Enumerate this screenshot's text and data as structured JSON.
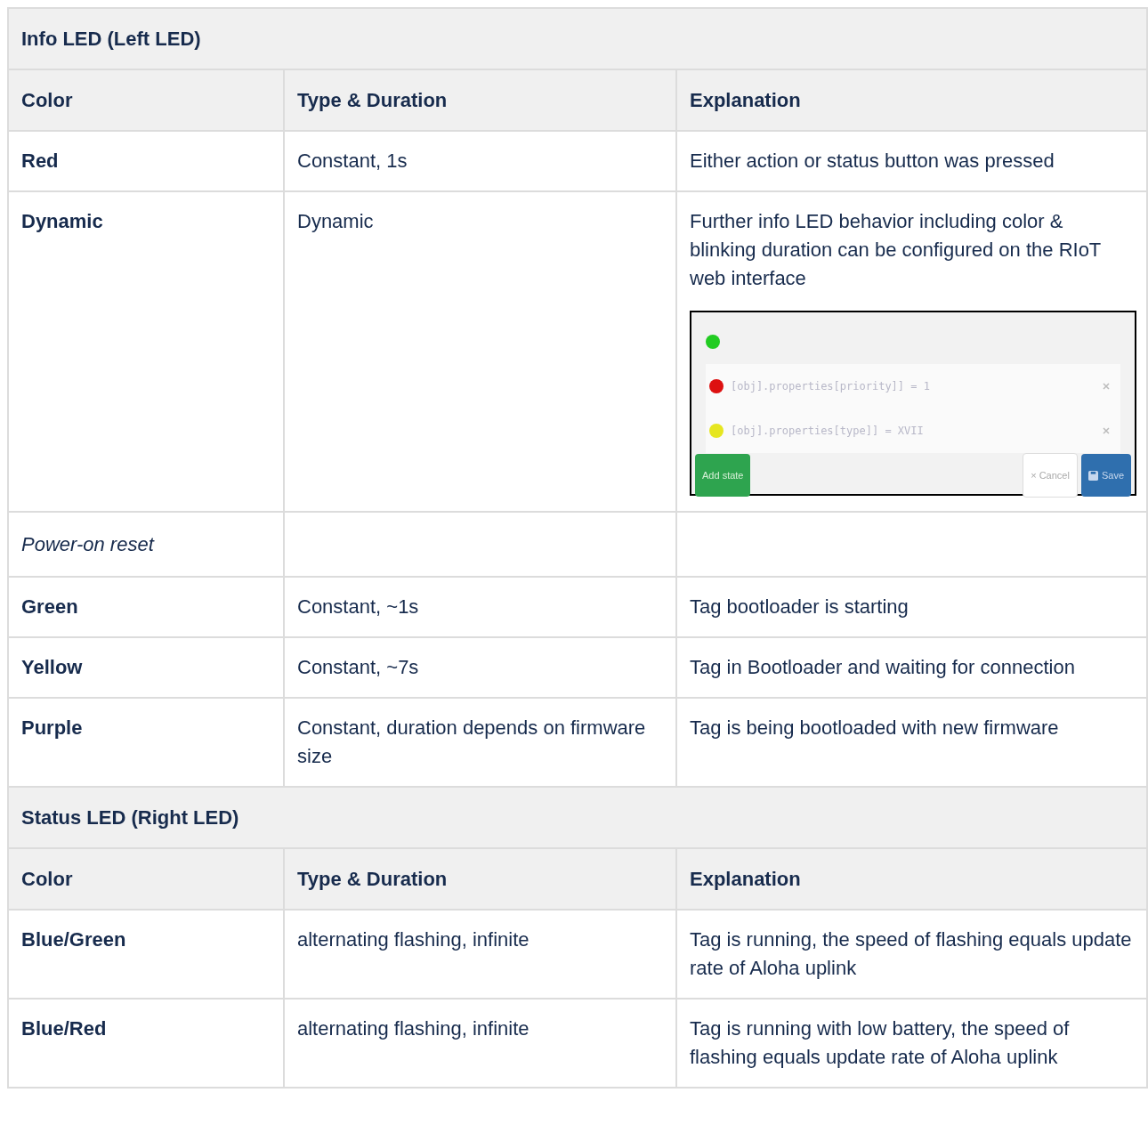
{
  "sections": [
    {
      "title": "Info LED (Left LED)",
      "columns": [
        "Color",
        "Type & Duration",
        "Explanation"
      ],
      "rows": [
        {
          "kind": "entry",
          "cells": [
            "Red",
            "Constant, 1s",
            "Either action or status button was pressed"
          ]
        },
        {
          "kind": "entry",
          "cells": [
            "Dynamic",
            "Dynamic",
            "Further info LED behavior including color & blinking duration can be configured on the RIoT web interface"
          ],
          "screenshot": {
            "states": [
              {
                "color": "#22cc22"
              },
              {
                "color": "#dd1111",
                "condition": "[obj].properties[priority]] = 1"
              },
              {
                "color": "#e6e620",
                "condition": "[obj].properties[type]] = XVII"
              }
            ],
            "add_button": "Add state",
            "cancel_button": "× Cancel",
            "save_button": "Save"
          }
        },
        {
          "kind": "group",
          "cells": [
            "Power-on reset"
          ]
        },
        {
          "kind": "entry",
          "cells": [
            "Green",
            "Constant, ~1s",
            "Tag bootloader is starting"
          ]
        },
        {
          "kind": "entry",
          "cells": [
            "Yellow",
            "Constant, ~7s",
            "Tag in Bootloader and waiting for connection"
          ]
        },
        {
          "kind": "entry",
          "cells": [
            "Purple",
            "Constant, duration depends on firmware size",
            "Tag is being bootloaded with new firmware"
          ]
        }
      ]
    },
    {
      "title": "Status LED (Right LED)",
      "columns": [
        "Color",
        "Type & Duration",
        "Explanation"
      ],
      "rows": [
        {
          "kind": "entry",
          "cells": [
            "Blue/Green",
            "alternating flashing, infinite",
            "Tag is running, the speed of flashing equals update rate of Aloha uplink"
          ]
        },
        {
          "kind": "entry",
          "cells": [
            "Blue/Red",
            "alternating flashing, infinite",
            "Tag is running with low battery, the speed of flashing equals update rate of Aloha uplink"
          ]
        }
      ]
    }
  ]
}
